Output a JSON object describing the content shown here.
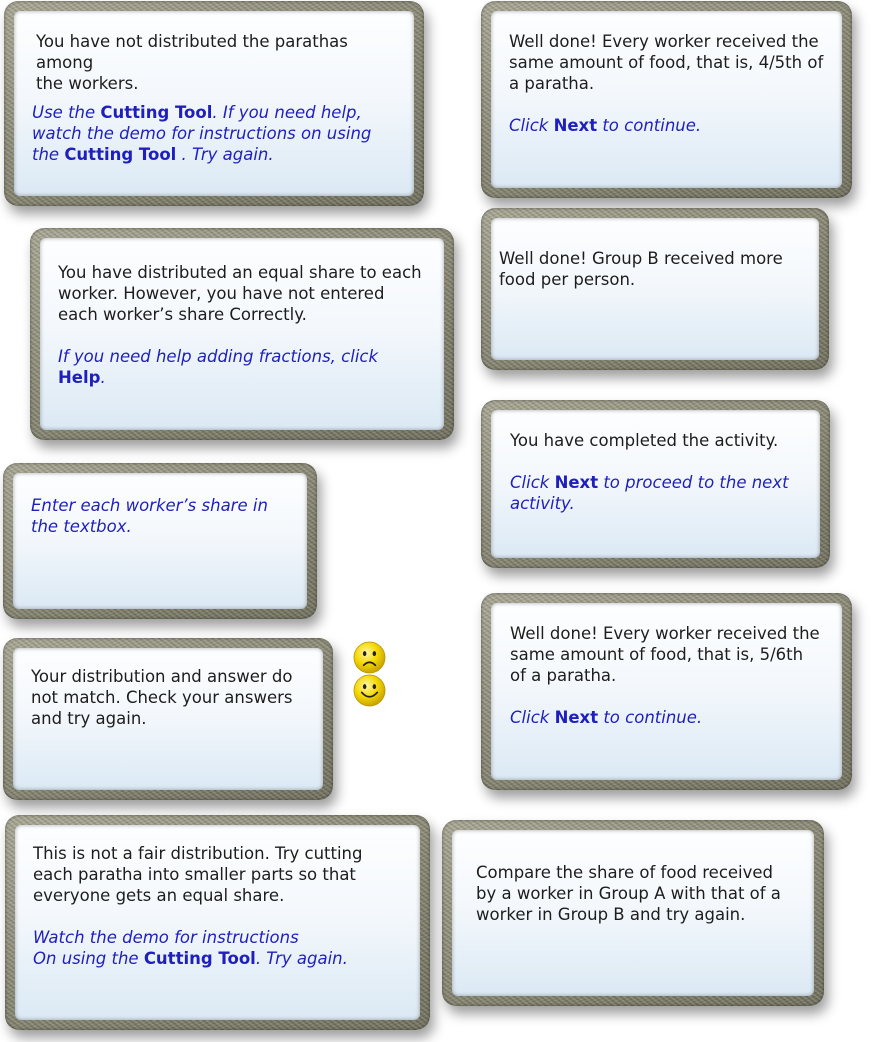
{
  "panels": {
    "not_distributed": {
      "line1": "You have not distributed the parathas among",
      "line2": "the workers.",
      "hint_a": "Use the ",
      "hint_b": "Cutting Tool",
      "hint_c": ". If you need help, watch the demo for instructions on using the ",
      "hint_d": "Cutting Tool",
      "hint_e": " . Try again."
    },
    "equal_share_not_entered": {
      "text": "You have distributed an equal share to each worker. However, you have not entered each worker’s share Correctly.",
      "hint_a": "If you need help adding fractions, click ",
      "hint_b": "Help",
      "hint_c": "."
    },
    "enter_share": {
      "hint": "Enter each worker’s share in the textbox."
    },
    "mismatch": {
      "text": "Your distribution and answer do not match. Check your answers and try again."
    },
    "not_fair": {
      "text": "This is not a fair distribution. Try cutting each paratha into smaller parts so that everyone gets an equal share.",
      "hint_a": "Watch the demo for instructions",
      "hint_b": "On using the ",
      "hint_c": "Cutting Tool",
      "hint_d": ". Try again."
    },
    "well_done_45": {
      "text": "Well done! Every worker received the same amount of food, that is, 4/5th of a paratha.",
      "hint_a": "Click ",
      "hint_b": "Next",
      "hint_c": " to continue."
    },
    "group_b": {
      "text": "Well done! Group B received more food per person."
    },
    "completed": {
      "text": "You have completed the activity.",
      "hint_a": "Click ",
      "hint_b": "Next",
      "hint_c": " to proceed to the next activity."
    },
    "well_done_56": {
      "text": "Well done! Every worker received the same amount of food, that is, 5/6th of a paratha.",
      "hint_a": "Click ",
      "hint_b": "Next",
      "hint_c": " to continue."
    },
    "compare": {
      "text": "Compare the share of food received by a worker in Group A with that of a  worker in Group B and try again."
    }
  },
  "icons": {
    "sad": "sad-face-icon",
    "happy": "happy-face-icon",
    "color": "#f2d500"
  }
}
